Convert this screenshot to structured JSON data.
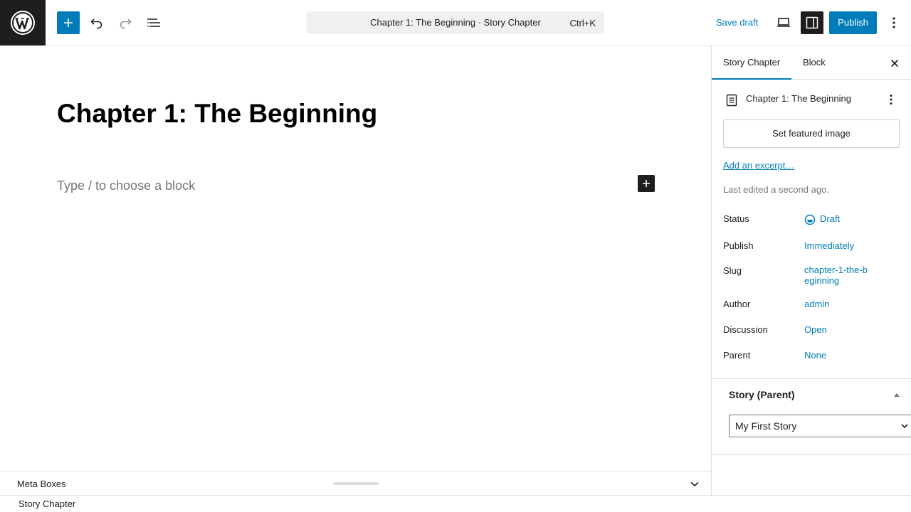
{
  "header": {
    "command_title": "Chapter 1: The Beginning · Story Chapter",
    "command_shortcut": "Ctrl+K",
    "save_draft": "Save draft",
    "publish": "Publish"
  },
  "editor": {
    "post_title": "Chapter 1: The Beginning",
    "block_placeholder": "Type / to choose a block"
  },
  "metaboxes": {
    "label": "Meta Boxes"
  },
  "footer": {
    "breadcrumb": "Story Chapter"
  },
  "sidebar": {
    "tabs": {
      "post": "Story Chapter",
      "block": "Block"
    },
    "post_card_title": "Chapter 1: The Beginning",
    "featured_image": "Set featured image",
    "excerpt": "Add an excerpt…",
    "last_edited": "Last edited a second ago.",
    "rows": {
      "status": {
        "label": "Status",
        "value": "Draft"
      },
      "publish": {
        "label": "Publish",
        "value": "Immediately"
      },
      "slug": {
        "label": "Slug",
        "value": "chapter-1-the-beginning"
      },
      "author": {
        "label": "Author",
        "value": "admin"
      },
      "discussion": {
        "label": "Discussion",
        "value": "Open"
      },
      "parent": {
        "label": "Parent",
        "value": "None"
      }
    },
    "story_panel": {
      "title": "Story (Parent)",
      "selected": "My First Story"
    }
  },
  "colors": {
    "accent": "#007cba",
    "dark": "#1e1e1e",
    "muted": "#757575"
  }
}
